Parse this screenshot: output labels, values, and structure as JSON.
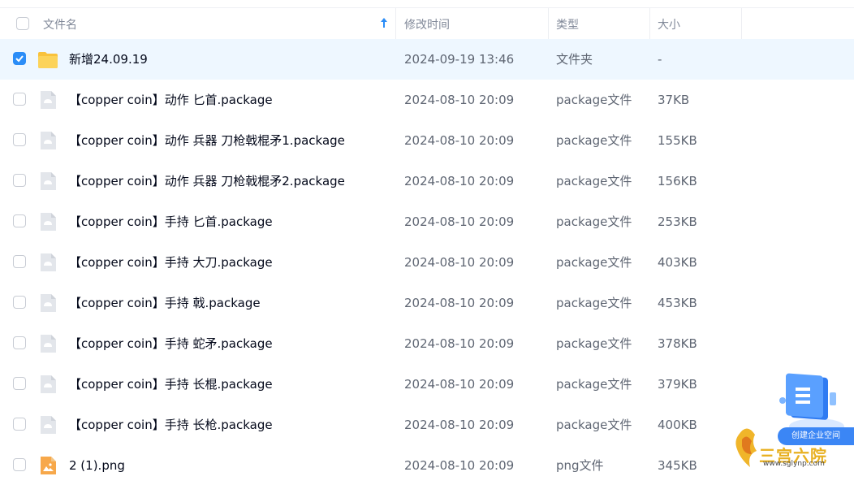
{
  "header": {
    "name": "文件名",
    "time": "修改时间",
    "type": "类型",
    "size": "大小"
  },
  "files": [
    {
      "name": "新增24.09.19",
      "time": "2024-09-19 13:46",
      "type": "文件夹",
      "size": "-",
      "icon": "folder-icon",
      "selected": true
    },
    {
      "name": "【copper coin】动作 匕首.package",
      "time": "2024-08-10 20:09",
      "type": "package文件",
      "size": "37KB",
      "icon": "package-file-icon",
      "selected": false
    },
    {
      "name": "【copper coin】动作 兵器 刀枪戟棍矛1.package",
      "time": "2024-08-10 20:09",
      "type": "package文件",
      "size": "155KB",
      "icon": "package-file-icon",
      "selected": false
    },
    {
      "name": "【copper coin】动作 兵器 刀枪戟棍矛2.package",
      "time": "2024-08-10 20:09",
      "type": "package文件",
      "size": "156KB",
      "icon": "package-file-icon",
      "selected": false
    },
    {
      "name": "【copper coin】手持 匕首.package",
      "time": "2024-08-10 20:09",
      "type": "package文件",
      "size": "253KB",
      "icon": "package-file-icon",
      "selected": false
    },
    {
      "name": "【copper coin】手持 大刀.package",
      "time": "2024-08-10 20:09",
      "type": "package文件",
      "size": "403KB",
      "icon": "package-file-icon",
      "selected": false
    },
    {
      "name": "【copper coin】手持 戟.package",
      "time": "2024-08-10 20:09",
      "type": "package文件",
      "size": "453KB",
      "icon": "package-file-icon",
      "selected": false
    },
    {
      "name": "【copper coin】手持 蛇矛.package",
      "time": "2024-08-10 20:09",
      "type": "package文件",
      "size": "378KB",
      "icon": "package-file-icon",
      "selected": false
    },
    {
      "name": "【copper coin】手持 长棍.package",
      "time": "2024-08-10 20:09",
      "type": "package文件",
      "size": "379KB",
      "icon": "package-file-icon",
      "selected": false
    },
    {
      "name": "【copper coin】手持 长枪.package",
      "time": "2024-08-10 20:09",
      "type": "package文件",
      "size": "400KB",
      "icon": "package-file-icon",
      "selected": false
    },
    {
      "name": "2 (1).png",
      "time": "2024-08-10 20:09",
      "type": "png文件",
      "size": "345KB",
      "icon": "image-file-icon",
      "selected": false
    }
  ],
  "widget": {
    "button_label": "创建企业空间",
    "watermark_text": "三宫六院",
    "watermark_url": "www.sglynp.com"
  },
  "colors": {
    "accent": "#2b8df7",
    "selected_row": "#eef7ff",
    "folder": "#f9c23c",
    "image_file": "#f7a84a"
  }
}
